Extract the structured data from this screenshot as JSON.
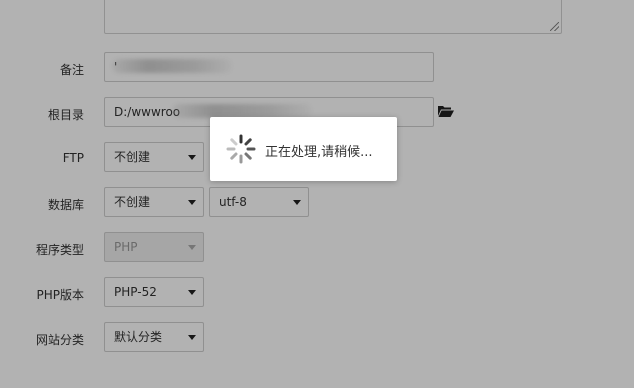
{
  "form": {
    "remark_label": "备注",
    "remark_value": "'",
    "root_label": "根目录",
    "root_value": "D:/wwwroo",
    "ftp_label": "FTP",
    "ftp_value": "不创建",
    "db_label": "数据库",
    "db_value": "不创建",
    "db_charset": "utf-8",
    "program_type_label": "程序类型",
    "program_type_value": "PHP",
    "php_version_label": "PHP版本",
    "php_version_value": "PHP-52",
    "site_category_label": "网站分类",
    "site_category_value": "默认分类"
  },
  "loading": {
    "message": "正在处理,请稍候..."
  },
  "icons": {
    "browse": "folder-open-icon",
    "spinner": "spinner-icon"
  }
}
